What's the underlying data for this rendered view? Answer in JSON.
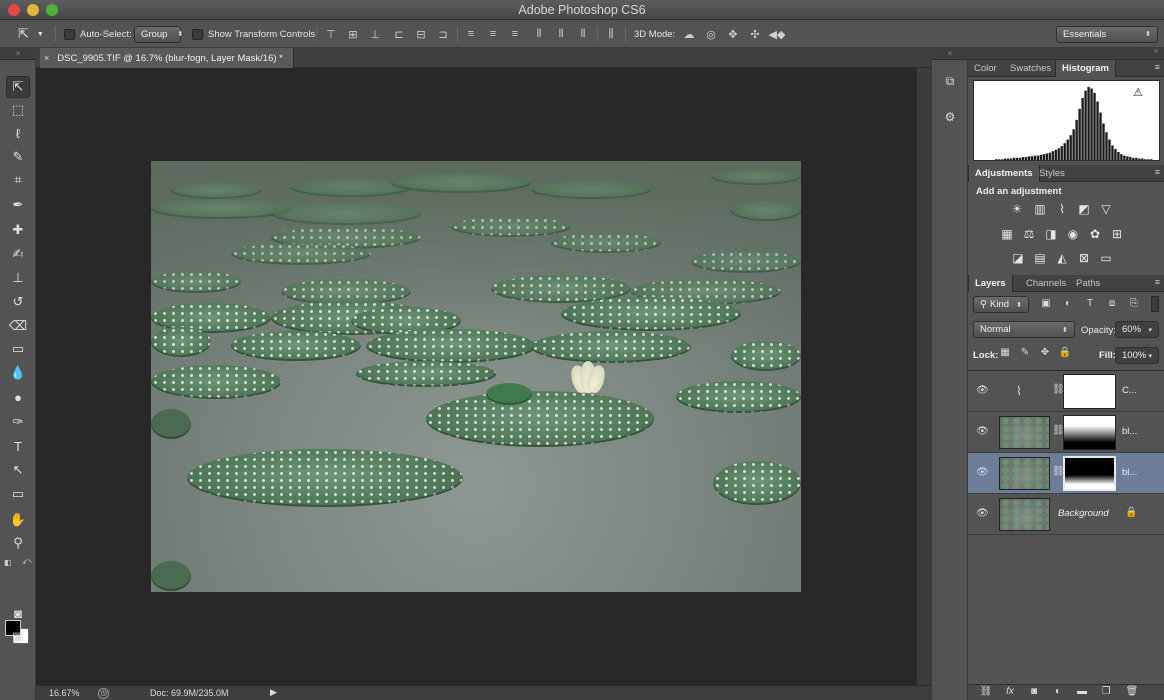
{
  "window": {
    "title": "Adobe Photoshop CS6"
  },
  "options_bar": {
    "auto_select_label": "Auto-Select:",
    "auto_select_value": "Group",
    "show_transform_label": "Show Transform Controls",
    "mode3d_label": "3D Mode:",
    "workspace": "Essentials"
  },
  "document": {
    "tab_title": "DSC_9905.TIF @ 16.7% (blur-fogn, Layer Mask/16) *",
    "close_glyph": "×"
  },
  "status_bar": {
    "zoom": "16.67%",
    "doc_info": "Doc: 69.9M/235.0M"
  },
  "panels": {
    "top_tabs": [
      "Color",
      "Swatches",
      "Histogram"
    ],
    "mid_tabs": [
      "Adjustments",
      "Styles"
    ],
    "adjustments_heading": "Add an adjustment",
    "layer_tabs": [
      "Layers",
      "Channels",
      "Paths"
    ]
  },
  "layers_panel": {
    "kind_filter": "Kind",
    "blend_mode": "Normal",
    "opacity_label": "Opacity:",
    "opacity_value": "60%",
    "lock_label": "Lock:",
    "fill_label": "Fill:",
    "fill_value": "100%",
    "layers": [
      {
        "name": "C...",
        "selected": false
      },
      {
        "name": "bl...",
        "selected": false
      },
      {
        "name": "bl...",
        "selected": true
      },
      {
        "name": "Background",
        "selected": false
      }
    ]
  },
  "colors": {
    "selected_layer": "#6c7d9a",
    "chrome": "#535353",
    "canvas_bg": "#282828"
  },
  "histogram": {
    "values": [
      0,
      0,
      0,
      0,
      0,
      0,
      0,
      1,
      1,
      1,
      2,
      2,
      2,
      3,
      3,
      3,
      4,
      4,
      5,
      5,
      6,
      6,
      7,
      8,
      9,
      10,
      12,
      14,
      16,
      19,
      23,
      28,
      34,
      42,
      55,
      70,
      85,
      95,
      100,
      98,
      92,
      80,
      65,
      50,
      38,
      28,
      20,
      15,
      11,
      8,
      6,
      5,
      4,
      3,
      3,
      2,
      2,
      1,
      1,
      1,
      0,
      0
    ]
  }
}
